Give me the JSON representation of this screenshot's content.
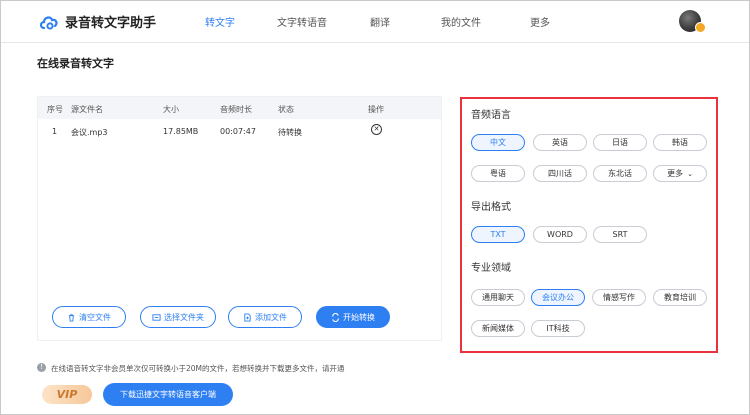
{
  "header": {
    "app_title": "录音转文字助手",
    "nav": [
      "转文字",
      "文字转语音",
      "翻译",
      "我的文件",
      "更多"
    ],
    "active_nav": "转文字"
  },
  "page_title": "在线录音转文字",
  "file_table": {
    "columns": [
      "序号",
      "源文件名",
      "大小",
      "音频时长",
      "状态",
      "操作"
    ],
    "rows": [
      {
        "index": "1",
        "name": "会议.mp3",
        "size": "17.85MB",
        "duration": "00:07:47",
        "status": "待转换"
      }
    ]
  },
  "actions": {
    "clear": "清空文件",
    "select_folder": "选择文件夹",
    "add_file": "添加文件",
    "start": "开始转换"
  },
  "settings": {
    "language_title": "音频语言",
    "languages": [
      "中文",
      "英语",
      "日语",
      "韩语",
      "粤语",
      "四川话",
      "东北话",
      "更多"
    ],
    "selected_language": "中文",
    "format_title": "导出格式",
    "formats": [
      "TXT",
      "WORD",
      "SRT"
    ],
    "selected_format": "TXT",
    "domain_title": "专业领域",
    "domains": [
      "通用聊天",
      "会议办公",
      "情感写作",
      "教育培训",
      "新闻媒体",
      "IT科技"
    ],
    "selected_domain": "会议办公"
  },
  "footer": {
    "notice": "在线语音转文字非会员单次仅可转换小于20M的文件，若想转换并下载更多文件，请开通",
    "vip": "VIP",
    "download": "下载迅捷文字转语音客户端"
  },
  "colors": {
    "accent": "#2e7ff2",
    "highlight_border": "#e8323c"
  }
}
